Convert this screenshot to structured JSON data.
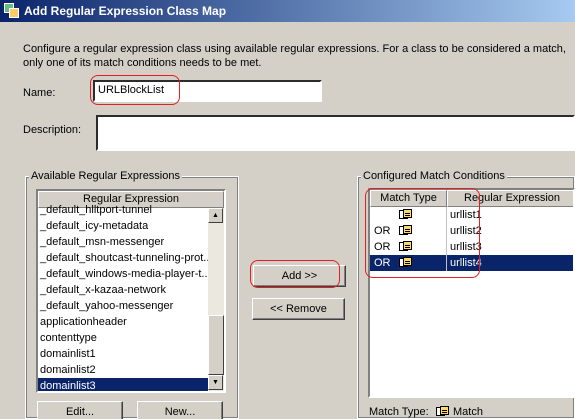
{
  "window": {
    "title": "Add Regular Expression Class Map"
  },
  "intro": "Configure a regular expression class using available regular expressions. For a class to be considered a match, only one of its match conditions needs to be met.",
  "form": {
    "name_label": "Name:",
    "name_value": "URLBlockList",
    "description_label": "Description:",
    "description_value": ""
  },
  "available": {
    "group_title": "Available Regular Expressions",
    "column": "Regular Expression",
    "items": [
      "_default_hlltport-tunnel",
      "_default_icy-metadata",
      "_default_msn-messenger",
      "_default_shoutcast-tunneling-prot...",
      "_default_windows-media-player-t...",
      "_default_x-kazaa-network",
      "_default_yahoo-messenger",
      "applicationheader",
      "contenttype",
      "domainlist1",
      "domainlist2",
      "domainlist3"
    ],
    "selected_index": 11,
    "edit_button": "Edit...",
    "new_button": "New..."
  },
  "actions": {
    "add_button": "Add >>",
    "remove_button": "<< Remove"
  },
  "configured": {
    "group_title": "Configured Match Conditions",
    "col_match_type": "Match Type",
    "col_regex": "Regular Expression",
    "rows": [
      {
        "op": "",
        "regex": "urllist1"
      },
      {
        "op": "OR",
        "regex": "urllist2"
      },
      {
        "op": "OR",
        "regex": "urllist3"
      },
      {
        "op": "OR",
        "regex": "urllist4"
      }
    ],
    "selected_index": 3,
    "footer_label": "Match Type:",
    "footer_value": "Match"
  },
  "colors": {
    "highlight": "#e02020",
    "selection": "#0a246a",
    "title_start": "#0a246a",
    "title_end": "#a6caf0"
  }
}
